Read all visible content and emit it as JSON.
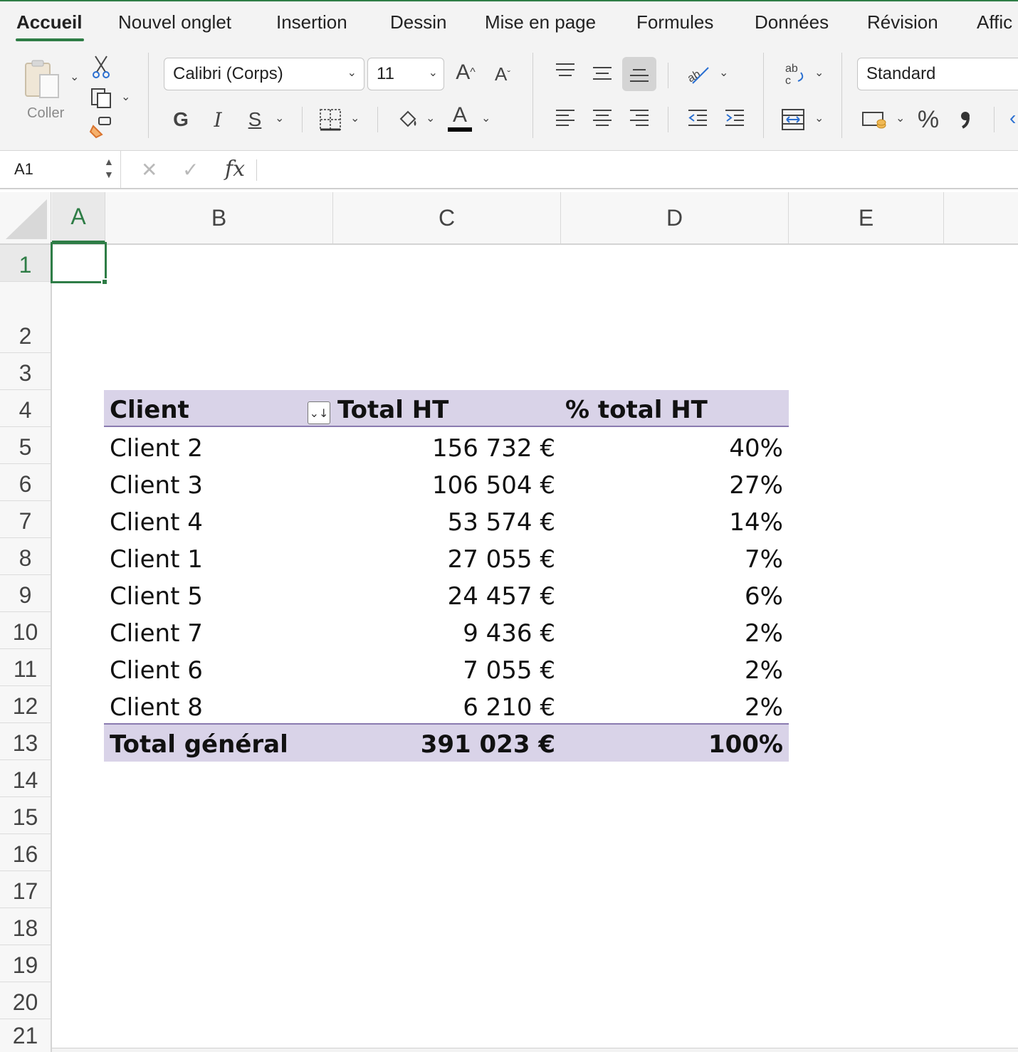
{
  "ribbon": {
    "tabs": [
      "Accueil",
      "Nouvel onglet",
      "Insertion",
      "Dessin",
      "Mise en page",
      "Formules",
      "Données",
      "Révision",
      "Affic"
    ],
    "active_tab": "Accueil",
    "paste_label": "Coller",
    "font_name": "Calibri (Corps)",
    "font_size": "11",
    "bold_label": "G",
    "italic_label": "I",
    "underline_label": "S",
    "number_format": "Standard",
    "percent_label": "%",
    "comma_label": "\t"
  },
  "formula_bar": {
    "name_box": "A1",
    "fx_label": "fx",
    "formula": ""
  },
  "columns": [
    "A",
    "B",
    "C",
    "D",
    "E"
  ],
  "rows": [
    "1",
    "2",
    "3",
    "4",
    "5",
    "6",
    "7",
    "8",
    "9",
    "10",
    "11",
    "12",
    "13",
    "14",
    "15",
    "16",
    "17",
    "18",
    "19",
    "20",
    "21"
  ],
  "pivot": {
    "headers": [
      "Client",
      "Total HT",
      "% total HT"
    ],
    "rows": [
      {
        "client": "Client 2",
        "total": "156 732 €",
        "pct": "40%"
      },
      {
        "client": "Client 3",
        "total": "106 504 €",
        "pct": "27%"
      },
      {
        "client": "Client 4",
        "total": "53 574 €",
        "pct": "14%"
      },
      {
        "client": "Client 1",
        "total": "27 055 €",
        "pct": "7%"
      },
      {
        "client": "Client 5",
        "total": "24 457 €",
        "pct": "6%"
      },
      {
        "client": "Client 7",
        "total": "9 436 €",
        "pct": "2%"
      },
      {
        "client": "Client 6",
        "total": "7 055 €",
        "pct": "2%"
      },
      {
        "client": "Client 8",
        "total": "6 210 €",
        "pct": "2%"
      }
    ],
    "grand_total": {
      "label": "Total général",
      "total": "391 023 €",
      "pct": "100%"
    }
  },
  "colors": {
    "accent": "#2e7d46",
    "pivot_band": "#d9d3e8",
    "pivot_rule": "#8a7bb0"
  }
}
